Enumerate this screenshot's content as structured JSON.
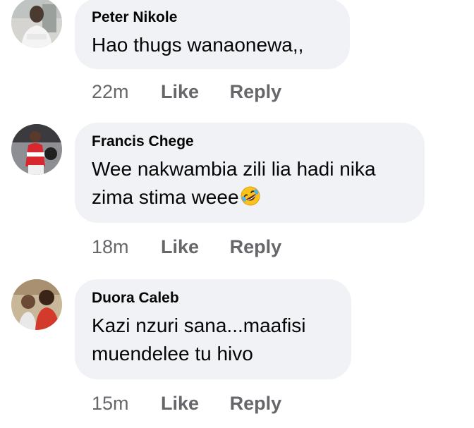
{
  "comments": [
    {
      "author": "Peter Nikole",
      "text": "Hao thugs wanaonewa,,",
      "time": "22m",
      "like_label": "Like",
      "reply_label": "Reply"
    },
    {
      "author": "Francis Chege",
      "text": "Wee nakwambia zili lia hadi nika\nzima stima weee",
      "emoji": "rolling-on-floor-laughing-emoji",
      "time": "18m",
      "like_label": "Like",
      "reply_label": "Reply"
    },
    {
      "author": "Duora Caleb",
      "text": "Kazi nzuri sana...maafisi\nmuendelee tu hivo",
      "time": "15m",
      "like_label": "Like",
      "reply_label": "Reply"
    }
  ],
  "colors": {
    "bubble": "#f0f2f5",
    "name_text": "#050505",
    "meta_text": "#65676b"
  }
}
